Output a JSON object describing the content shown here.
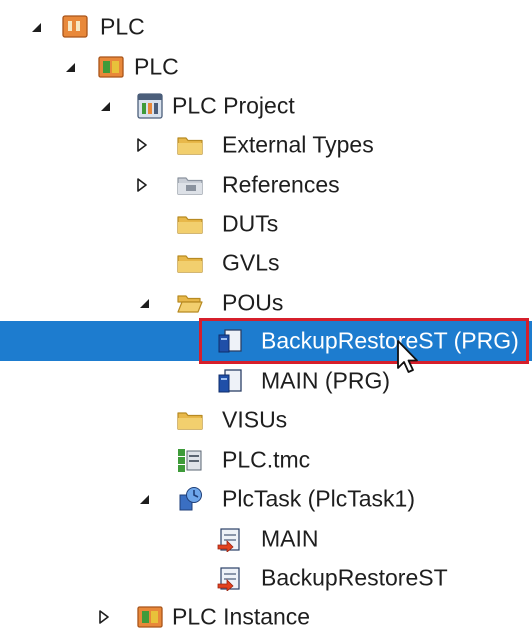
{
  "tree": {
    "nodes": [
      {
        "key": "plc_root",
        "label": "PLC",
        "state": "expanded",
        "icon": "plc-project-icon"
      },
      {
        "key": "plc",
        "label": "PLC",
        "state": "expanded",
        "icon": "plc-icon"
      },
      {
        "key": "plc_project",
        "label": "PLC Project",
        "state": "expanded",
        "icon": "plc-project-file-icon"
      },
      {
        "key": "external_types",
        "label": "External Types",
        "state": "collapsed",
        "icon": "folder-icon"
      },
      {
        "key": "references",
        "label": "References",
        "state": "collapsed",
        "icon": "references-folder-icon"
      },
      {
        "key": "duts",
        "label": "DUTs",
        "state": "leaf",
        "icon": "folder-icon"
      },
      {
        "key": "gvls",
        "label": "GVLs",
        "state": "leaf",
        "icon": "folder-icon"
      },
      {
        "key": "pous",
        "label": "POUs",
        "state": "expanded",
        "icon": "folder-open-icon"
      },
      {
        "key": "backup_restore_st_prg",
        "label": "BackupRestoreST (PRG)",
        "state": "leaf",
        "icon": "pou-program-icon",
        "selected": true
      },
      {
        "key": "main_prg",
        "label": "MAIN (PRG)",
        "state": "leaf",
        "icon": "pou-program-icon"
      },
      {
        "key": "visus",
        "label": "VISUs",
        "state": "leaf",
        "icon": "folder-icon"
      },
      {
        "key": "plc_tmc",
        "label": "PLC.tmc",
        "state": "leaf",
        "icon": "tmc-file-icon"
      },
      {
        "key": "plctask",
        "label": "PlcTask (PlcTask1)",
        "state": "expanded",
        "icon": "task-icon"
      },
      {
        "key": "task_main",
        "label": "MAIN",
        "state": "leaf",
        "icon": "task-call-icon"
      },
      {
        "key": "task_backup_restore_st",
        "label": "BackupRestoreST",
        "state": "leaf",
        "icon": "task-call-icon"
      },
      {
        "key": "plc_instance",
        "label": "PLC Instance",
        "state": "collapsed",
        "icon": "plc-instance-icon"
      }
    ]
  },
  "colors": {
    "selection": "#1d7ccf",
    "highlight_border": "#d61f2b",
    "folder": "#e8b84a"
  }
}
